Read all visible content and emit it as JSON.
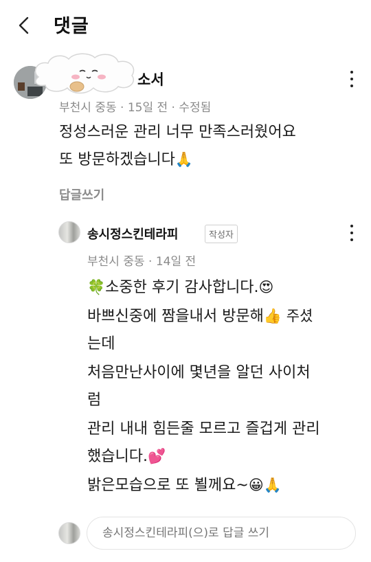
{
  "header": {
    "title": "댓글"
  },
  "comment": {
    "author_visible": "소서",
    "meta": "부천시 중동 · 15일 전 · 수정됨",
    "lines": [
      "정성스러운 관리 너무 만족스러웠어요",
      "또 방문하겠습니다"
    ],
    "line2_emoji": "🙏",
    "reply_link": "답글쓰기"
  },
  "reply": {
    "author": "송시정스킨테라피",
    "badge": "작성자",
    "meta": "부천시 중동 · 14일 전",
    "lines": [
      {
        "pre": "🍀",
        "text": "소중한 후기 감사합니다.",
        "post": "😍"
      },
      {
        "pre": "",
        "text": "바쁘신중에 짬을내서 방문해",
        "post": "👍 주셨"
      },
      {
        "pre": "",
        "text": "는데",
        "post": ""
      },
      {
        "pre": "",
        "text": "처음만난사이에 몇년을 알던 사이처",
        "post": ""
      },
      {
        "pre": "",
        "text": "럼",
        "post": ""
      },
      {
        "pre": "",
        "text": "관리 내내 힘든줄 모르고 즐겁게 관리",
        "post": ""
      },
      {
        "pre": "",
        "text": "했습니다.",
        "post": "💕"
      },
      {
        "pre": "",
        "text": "밝은모습으로 또 뵐께요~",
        "post": "😀🙏"
      }
    ]
  },
  "composer": {
    "placeholder": "송시정스킨테라피(으)로 답글 쓰기"
  }
}
